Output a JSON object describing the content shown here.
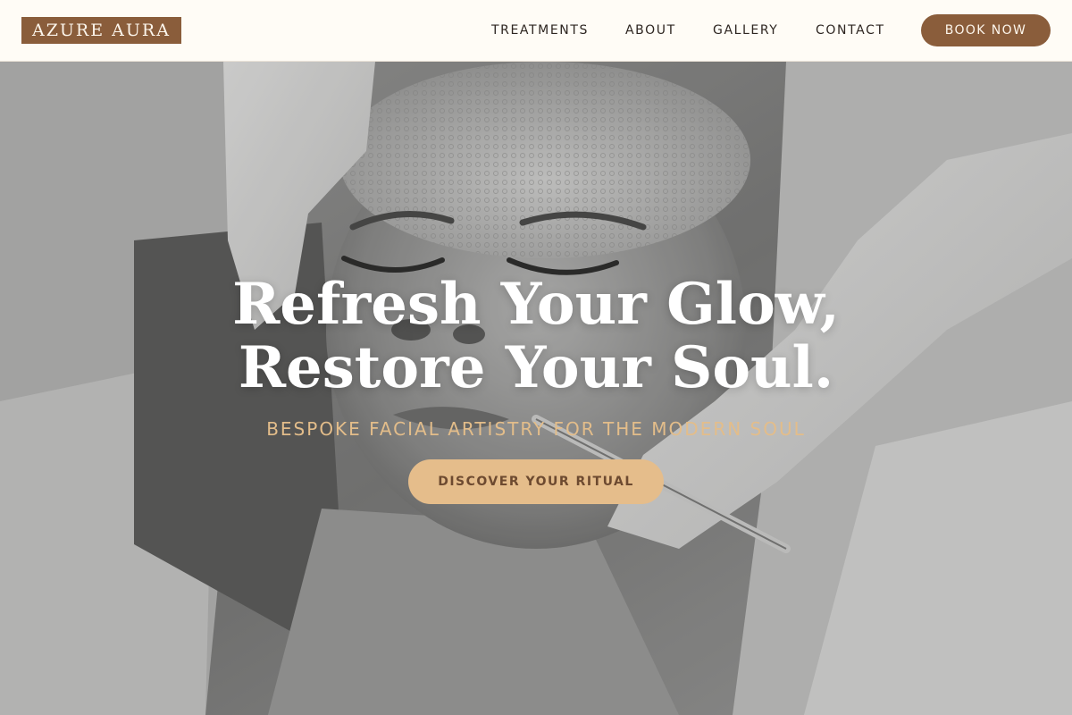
{
  "brand": {
    "name": "AZURE AURA"
  },
  "nav": {
    "items": [
      {
        "label": "TREATMENTS"
      },
      {
        "label": "ABOUT"
      },
      {
        "label": "GALLERY"
      },
      {
        "label": "CONTACT"
      }
    ],
    "cta_label": "BOOK NOW"
  },
  "hero": {
    "headline_line1": "Refresh Your Glow,",
    "headline_line2": "Restore Your Soul.",
    "tagline": "BESPOKE FACIAL ARTISTRY FOR THE MODERN SOUL",
    "cta_label": "DISCOVER YOUR RITUAL"
  },
  "colors": {
    "accent_brown": "#8a5d3b",
    "accent_sand": "#e5bd8b",
    "header_bg": "#fffcf6",
    "tagline": "#e3bd8a"
  }
}
